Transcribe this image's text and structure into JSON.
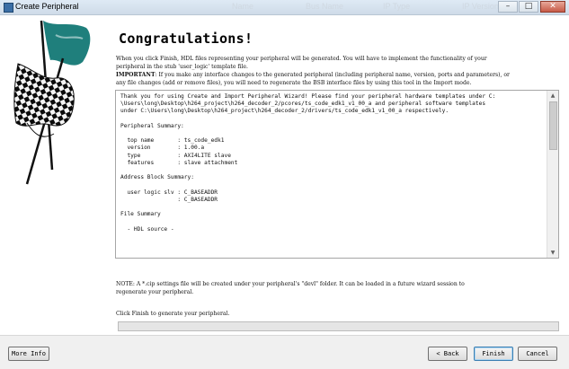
{
  "window": {
    "title": "Create Peripheral",
    "ghost_labels": [
      "Name",
      "Bus Name",
      "IP Type",
      "IP Version"
    ],
    "minimize": "–",
    "maximize": "□",
    "close": "✕"
  },
  "header": {
    "title": "Congratulations!"
  },
  "intro": {
    "line1": "When you click Finish, HDL files representing your peripheral will be generated. You will have to implement the functionality of your",
    "line2": "peripheral in the stub 'user_logic' template file.",
    "important_label": "IMPORTANT",
    "important_line1": ": If you make any interface changes to the generated peripheral (including peripheral name, version, ports and parameters), or",
    "important_line2": "any file changes (add or remove files), you will need to regenerate the BSB interface files by using this tool in the Import mode."
  },
  "summary_lines": [
    "Thank you for using Create and Import Peripheral Wizard! Please find your peripheral hardware templates under C:",
    "\\Users\\long\\Desktop\\h264_project\\h264_decoder_2/pcores/ts_code_edk1_v1_00_a and peripheral software templates",
    "under C:\\Users\\long\\Desktop\\h264_project\\h264_decoder_2/drivers/ts_code_edk1_v1_00_a respectively.",
    "",
    "Peripheral Summary:",
    "",
    "  top name       : ts_code_edk1",
    "  version        : 1.00.a",
    "  type           : AXI4LITE slave",
    "  features       : slave attachment",
    "",
    "Address Block Summary:",
    "",
    "  user logic slv : C_BASEADDR",
    "                 : C_BASEADDR",
    "",
    "File Summary",
    "",
    "  - HDL source -"
  ],
  "notes": {
    "note": "NOTE: A *.cip settings file will be created under your peripheral's \"devl\" folder. It can be loaded in a future  wizard session to",
    "note2": "regenerate your peripheral.",
    "finish_hint": "Click Finish to generate your peripheral."
  },
  "progress": {
    "value": 0
  },
  "buttons": {
    "more_info": "More Info",
    "back": "< Back",
    "finish": "Finish",
    "cancel": "Cancel"
  },
  "scrollbar": {
    "up": "▲",
    "down": "▼"
  },
  "colors": {
    "flag_teal": "#1f7f7c",
    "flag_dark": "#0b0b0b"
  }
}
